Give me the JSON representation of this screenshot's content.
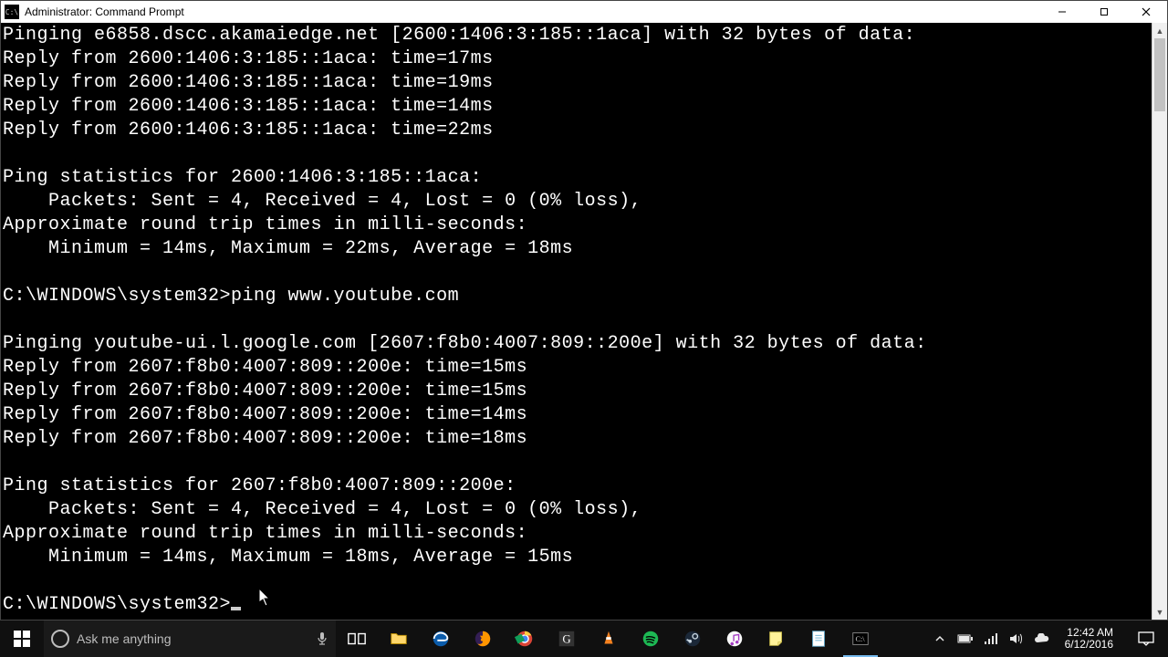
{
  "window": {
    "title": "Administrator: Command Prompt",
    "icon_label": "C:\\"
  },
  "terminal": {
    "lines": [
      "Pinging e6858.dscc.akamaiedge.net [2600:1406:3:185::1aca] with 32 bytes of data:",
      "Reply from 2600:1406:3:185::1aca: time=17ms",
      "Reply from 2600:1406:3:185::1aca: time=19ms",
      "Reply from 2600:1406:3:185::1aca: time=14ms",
      "Reply from 2600:1406:3:185::1aca: time=22ms",
      "",
      "Ping statistics for 2600:1406:3:185::1aca:",
      "    Packets: Sent = 4, Received = 4, Lost = 0 (0% loss),",
      "Approximate round trip times in milli-seconds:",
      "    Minimum = 14ms, Maximum = 22ms, Average = 18ms",
      "",
      "C:\\WINDOWS\\system32>ping www.youtube.com",
      "",
      "Pinging youtube-ui.l.google.com [2607:f8b0:4007:809::200e] with 32 bytes of data:",
      "Reply from 2607:f8b0:4007:809::200e: time=15ms",
      "Reply from 2607:f8b0:4007:809::200e: time=15ms",
      "Reply from 2607:f8b0:4007:809::200e: time=14ms",
      "Reply from 2607:f8b0:4007:809::200e: time=18ms",
      "",
      "Ping statistics for 2607:f8b0:4007:809::200e:",
      "    Packets: Sent = 4, Received = 4, Lost = 0 (0% loss),",
      "Approximate round trip times in milli-seconds:",
      "    Minimum = 14ms, Maximum = 18ms, Average = 15ms",
      ""
    ],
    "prompt": "C:\\WINDOWS\\system32>"
  },
  "search": {
    "placeholder": "Ask me anything"
  },
  "tray": {
    "time": "12:42 AM",
    "date": "6/12/2016"
  }
}
